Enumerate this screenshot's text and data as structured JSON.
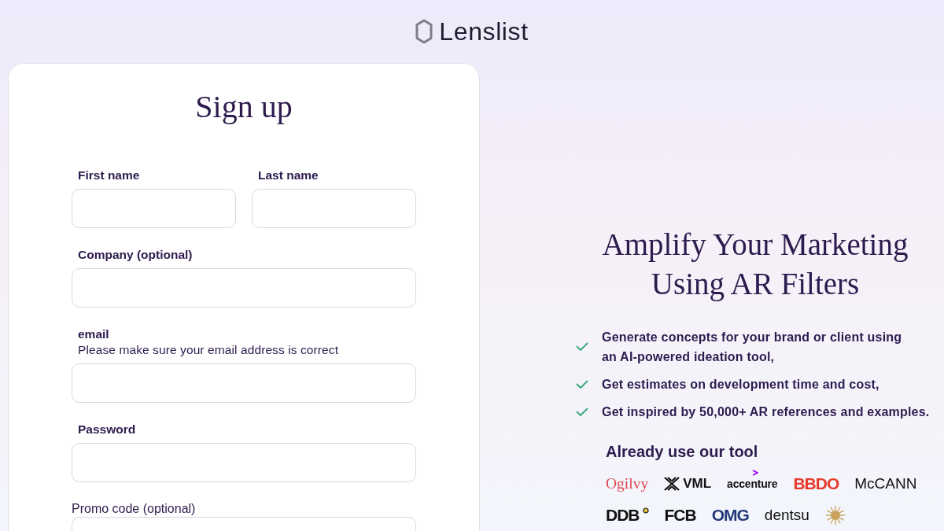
{
  "header": {
    "brand": "Lenslist"
  },
  "signup_form": {
    "title": "Sign up",
    "rows": [
      {
        "fields": [
          {
            "label": "First name",
            "kind": "standard"
          },
          {
            "label": "Last name",
            "kind": "standard"
          }
        ]
      },
      {
        "fields": [
          {
            "label": "Company (optional)",
            "kind": "standard"
          }
        ]
      },
      {
        "fields": [
          {
            "label": "email",
            "hint": "Please make sure your email address is correct",
            "kind": "standard"
          }
        ]
      },
      {
        "fields": [
          {
            "label": "Password",
            "kind": "standard"
          }
        ]
      },
      {
        "fields": [
          {
            "label": "Promo code (optional)",
            "kind": "plain"
          }
        ]
      }
    ]
  },
  "promo_panel": {
    "heading": "Amplify Your Marketing Using AR Filters",
    "benefits": [
      {
        "text": "Generate concepts for your brand or client using\nan AI-powered ideation tool,"
      },
      {
        "text": "Get estimates on development time and cost,"
      },
      {
        "text": "Get inspired by 50,000+ AR references and examples."
      }
    ],
    "clients": {
      "title": "Already use our tool",
      "logos": [
        {
          "name": "Ogilvy",
          "kind": "serif",
          "color": "#e0474f"
        },
        {
          "name": "VML",
          "kind": "crossmark",
          "color": "#111111"
        },
        {
          "name": "accenture",
          "kind": "chevron",
          "color": "#111111"
        },
        {
          "name": "BBDO",
          "kind": "heavy",
          "color": "#e63b2b"
        },
        {
          "name": "McCANN",
          "kind": "sans",
          "color": "#111111"
        },
        {
          "name": "DDB",
          "kind": "dot",
          "color": "#111111"
        },
        {
          "name": "FCB",
          "kind": "heavy",
          "color": "#111111"
        },
        {
          "name": "OMG",
          "kind": "heavy",
          "color": "#23397a"
        },
        {
          "name": "dentsu",
          "kind": "sans",
          "color": "#111111"
        },
        {
          "kind": "emblem",
          "color": "#c9a35c"
        }
      ]
    }
  }
}
